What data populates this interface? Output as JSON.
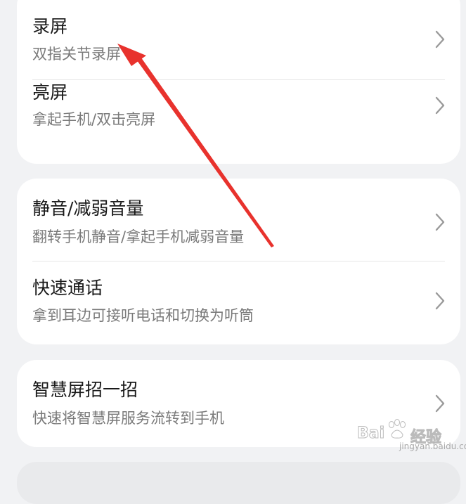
{
  "cards": [
    {
      "items": [
        {
          "title": "录屏",
          "subtitle": "双指关节录屏"
        },
        {
          "title": "亮屏",
          "subtitle": "拿起手机/双击亮屏"
        }
      ]
    },
    {
      "items": [
        {
          "title": "静音/减弱音量",
          "subtitle": "翻转手机静音/拿起手机减弱音量"
        },
        {
          "title": "快速通话",
          "subtitle": "拿到耳边可接听电话和切换为听筒"
        }
      ]
    },
    {
      "items": [
        {
          "title": "智慧屏招一招",
          "subtitle": "快速将智慧屏服务流转到手机"
        }
      ]
    }
  ],
  "watermark": {
    "text": "Bai",
    "text2": "经验",
    "sub": "jingyan.baidu.com"
  },
  "colors": {
    "annotation_arrow": "#e8322d",
    "background": "#f1f2f4",
    "card": "#ffffff"
  }
}
